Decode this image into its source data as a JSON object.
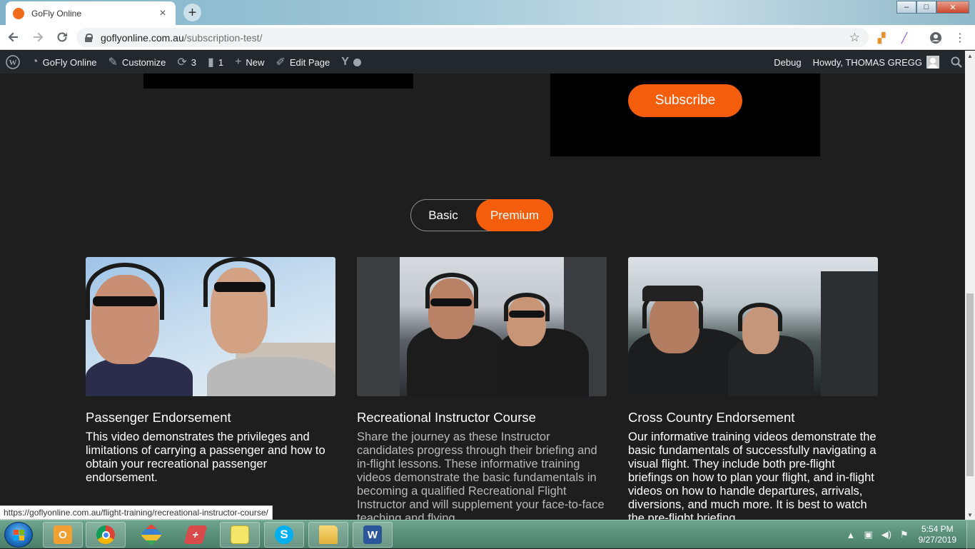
{
  "browser": {
    "tab_title": "GoFly Online",
    "tab_close": "×",
    "new_tab": "+",
    "window_controls": {
      "minimize": "–",
      "maximize": "□",
      "close": "✕"
    },
    "url_host": "goflyonline.com.au",
    "url_path": "/subscription-test/",
    "status_url": "https://goflyonline.com.au/flight-training/recreational-instructor-course/"
  },
  "adminbar": {
    "site_name": "GoFly Online",
    "customize": "Customize",
    "updates_count": "3",
    "comments_count": "1",
    "new": "New",
    "edit_page": "Edit Page",
    "debug": "Debug",
    "howdy": "Howdy, THOMAS GREGG"
  },
  "page": {
    "subscribe_label": "Subscribe",
    "toggle": {
      "basic": "Basic",
      "premium": "Premium",
      "selected": "Premium"
    },
    "accent_color": "#f45d0c",
    "cards": [
      {
        "title": "Passenger Endorsement",
        "description": "This video demonstrates the privileges and limitations of carrying a passenger and  how to obtain your recreational passenger endorsement."
      },
      {
        "title": "Recreational Instructor Course",
        "description": "Share the journey as these Instructor candidates progress through their briefing and in-flight lessons. These informative training videos demonstrate the basic fundamentals in becoming a qualified Recreational Flight Instructor and will supplement your face-to-face teaching and flying."
      },
      {
        "title": "Cross Country Endorsement",
        "description": "Our informative training videos demonstrate the basic fundamentals of successfully navigating a visual flight. They include both pre-flight briefings on how to plan your flight, and in-flight videos on how to handle departures, arrivals, diversions, and much more. It is best to watch the  pre-flight briefing"
      }
    ]
  },
  "taskbar": {
    "apps": [
      "outlook",
      "chrome",
      "app-grid",
      "eraser-app",
      "sticky-notes",
      "skype",
      "file-explorer",
      "word"
    ],
    "time": "5:54 PM",
    "date": "9/27/2019"
  }
}
